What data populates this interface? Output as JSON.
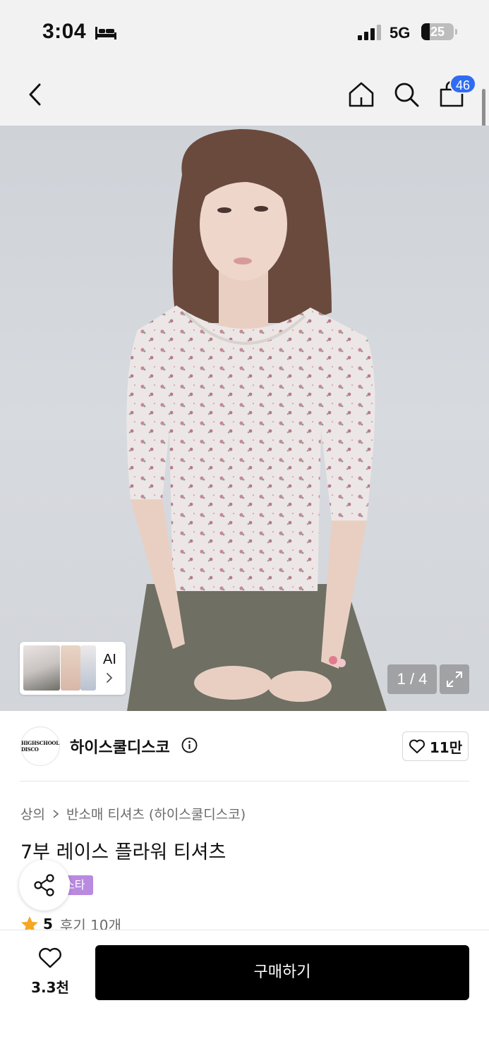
{
  "status_bar": {
    "time": "3:04",
    "network": "5G",
    "battery": "25",
    "battery_level": 0.25,
    "icons": [
      "bed-icon",
      "signal-icon",
      "battery-icon"
    ]
  },
  "nav": {
    "icons": [
      "back-arrow-icon",
      "home-icon",
      "search-icon",
      "shopping-bag-icon"
    ],
    "cart_badge": "46"
  },
  "gallery": {
    "ai_label": "AI",
    "page_counter": "1 / 4",
    "expand_icon": "expand-icon"
  },
  "brand": {
    "name": "하이스쿨디스코",
    "logo_text": "HIGHSCHOOL DISCO",
    "likes": "11만"
  },
  "product": {
    "breadcrumb": [
      "상의",
      "반소매 티셔츠 (하이스쿨디스코)"
    ],
    "title": "7부 레이스 플라워 티셔츠",
    "tag": "스타",
    "rating": "5",
    "review_label": "후기 10개"
  },
  "bottom": {
    "likes": "3.3천",
    "buy_label": "구매하기"
  },
  "colors": {
    "accent_blue": "#2f6cf3",
    "tag_purple": "#b98ae0",
    "star": "#f5a623",
    "buy_button": "#000000"
  }
}
